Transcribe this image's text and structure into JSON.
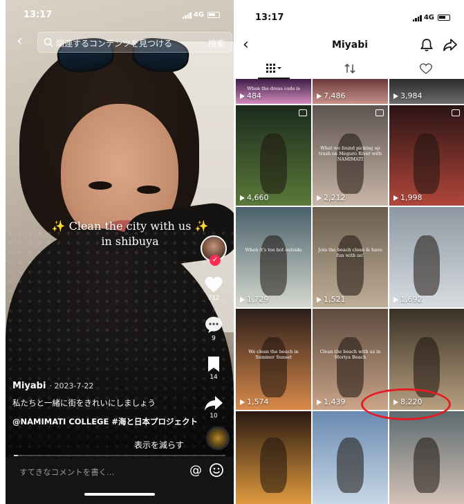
{
  "left": {
    "status": {
      "time": "13:17",
      "network": "4G"
    },
    "search": {
      "placeholder": "関連するコンテンツを見つける",
      "button": "検索"
    },
    "caption": [
      "✨ Clean the city with us ✨",
      "in shibuya"
    ],
    "rail": {
      "likes": "712",
      "comments": "9",
      "saves": "14",
      "shares": "10"
    },
    "meta": {
      "username": "Miyabi",
      "date": "· 2023-7-22",
      "description": "私たちと一緒に街をきれいにしましょう",
      "tags": "@NAMIMATI COLLEGE #海と日本プロジェクト",
      "show_less": "表示を減らす"
    },
    "comment_placeholder": "すてきなコメントを書く..."
  },
  "right": {
    "status": {
      "time": "13:17",
      "network": "4G"
    },
    "profile_title": "Miyabi",
    "grid": [
      {
        "views": "484",
        "caption": "When the dress code is",
        "palette": [
          "#3a1e46",
          "#d48bbd"
        ]
      },
      {
        "views": "7,486",
        "caption": "",
        "palette": [
          "#6a3a3a",
          "#c9928a"
        ]
      },
      {
        "views": "3,984",
        "caption": "",
        "palette": [
          "#2b2b2b",
          "#6c6c6c"
        ]
      },
      {
        "views": "4,660",
        "caption": "",
        "palette": [
          "#1c2b1d",
          "#5a7a3a"
        ],
        "pinned": true
      },
      {
        "views": "2,212",
        "caption": "What we found picking up trash on Meguro River with NAMIMATI",
        "palette": [
          "#5e5450",
          "#c9b7a8"
        ],
        "pinned": true
      },
      {
        "views": "1,998",
        "caption": "",
        "palette": [
          "#2a1414",
          "#b2463b"
        ],
        "pinned": true
      },
      {
        "views": "1,729",
        "caption": "When it's too hot outside",
        "palette": [
          "#49606a",
          "#d6d9d0"
        ]
      },
      {
        "views": "1,521",
        "caption": "Join the beach clean & have fun with us!",
        "palette": [
          "#6a5d4e",
          "#bfae98"
        ]
      },
      {
        "views": "1,692",
        "caption": "",
        "palette": [
          "#8c98a2",
          "#d9dde1"
        ]
      },
      {
        "views": "1,574",
        "caption": "We clean the beach in Summer Sunset",
        "palette": [
          "#2b1e1a",
          "#d98a4b"
        ]
      },
      {
        "views": "1,439",
        "caption": "Clean the beach with us in Moriya Beach",
        "palette": [
          "#5d4a3e",
          "#caa488"
        ]
      },
      {
        "views": "8,220",
        "caption": "",
        "palette": [
          "#3a3126",
          "#b8a080"
        ]
      },
      {
        "views": "",
        "caption": "",
        "palette": [
          "#2a1a12",
          "#e09a3e"
        ]
      },
      {
        "views": "",
        "caption": "",
        "palette": [
          "#6a8ab0",
          "#c8d8e6"
        ]
      },
      {
        "views": "",
        "caption": "",
        "palette": [
          "#5c6a6e",
          "#d4c2b8"
        ]
      }
    ],
    "highlighted_views": "8,220"
  }
}
